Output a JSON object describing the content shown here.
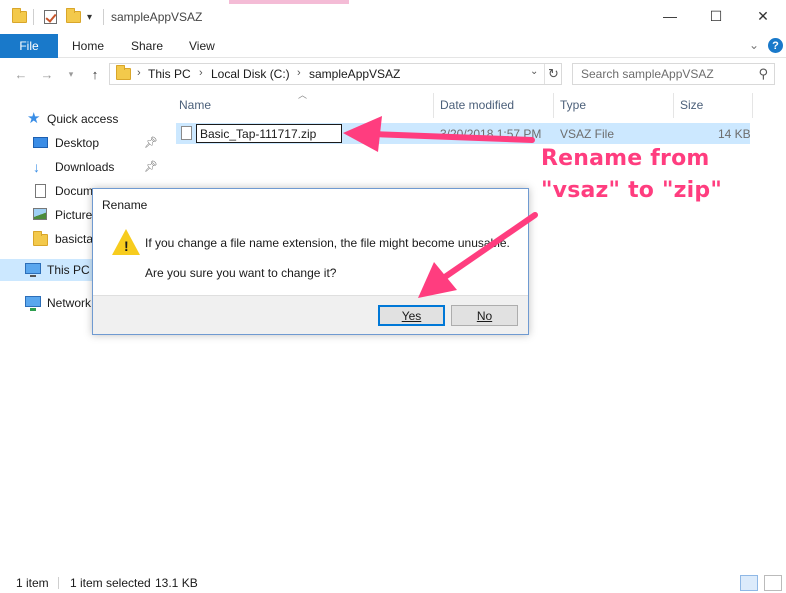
{
  "window": {
    "title": "sampleAppVSAZ",
    "controls": [
      "—",
      "☐",
      "✕"
    ]
  },
  "ribbon": {
    "tabs": [
      "File",
      "Home",
      "Share",
      "View"
    ],
    "expand_icon": "chevron-down-icon",
    "help_icon": "help-icon"
  },
  "address": {
    "crumbs": [
      "This PC",
      "Local Disk (C:)",
      "sampleAppVSAZ"
    ],
    "search_placeholder": "Search sampleAppVSAZ"
  },
  "nav_pane": {
    "items": [
      {
        "label": "Quick access",
        "icon": "star-icon"
      },
      {
        "label": "Desktop",
        "icon": "desktop-icon"
      },
      {
        "label": "Downloads",
        "icon": "downloads-icon"
      },
      {
        "label": "Docum",
        "icon": "documents-icon"
      },
      {
        "label": "Picture",
        "icon": "pictures-icon"
      },
      {
        "label": "basicta",
        "icon": "folder-icon"
      },
      {
        "label": "This PC",
        "icon": "this-pc-icon"
      },
      {
        "label": "Network",
        "icon": "network-icon"
      }
    ]
  },
  "file_list": {
    "columns": [
      "Name",
      "Date modified",
      "Type",
      "Size"
    ],
    "rows": [
      {
        "name": "Basic_Tap-111717.zip",
        "date": "3/20/2018 1:57 PM",
        "type": "VSAZ File",
        "size": "14 KB"
      }
    ]
  },
  "dialog": {
    "title": "Rename",
    "message_line1": "If you change a file name extension, the file might become unusable.",
    "message_line2": "Are you sure you want to change it?",
    "yes_label": "Yes",
    "no_label": "No"
  },
  "annotation": {
    "line1": "Rename from",
    "line2": "\"vsaz\" to \"zip\"",
    "color": "#ff3d7f"
  },
  "status_bar": {
    "item_count": "1 item",
    "selected": "1 item selected",
    "size": "13.1 KB"
  },
  "colors": {
    "accent": "#1979ca",
    "selection": "#cce8ff",
    "warning": "#f7cc1e"
  }
}
